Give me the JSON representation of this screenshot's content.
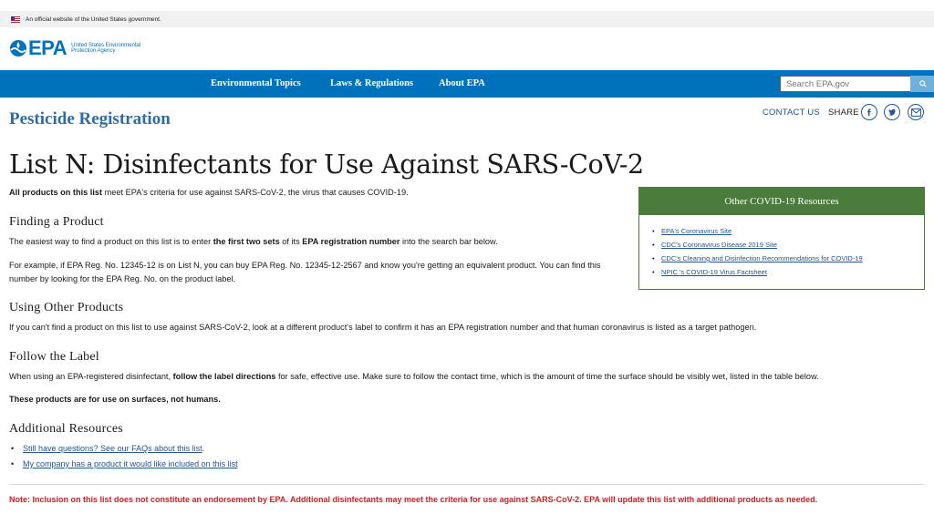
{
  "gov_banner": {
    "text": "An official website of the United States government."
  },
  "header": {
    "logo_text": "EPA",
    "logo_sub": "United States Environmental Protection Agency"
  },
  "nav": {
    "items": [
      "Environmental Topics",
      "Laws & Regulations",
      "About EPA"
    ],
    "search_placeholder": "Search EPA.gov"
  },
  "title_row": {
    "site_title": "Pesticide Registration",
    "contact": "CONTACT US",
    "share": "SHARE",
    "social_icons": [
      "facebook-icon",
      "twitter-icon",
      "email-icon"
    ]
  },
  "main": {
    "h1": "List N: Disinfectants for Use Against SARS-CoV-2",
    "intro_bold": "All products on this list",
    "intro_rest": " meet EPA's criteria for use against SARS-CoV-2, the virus that causes COVID-19.",
    "finding": {
      "heading": "Finding a Product",
      "p1_a": "The easiest way to find a product on this list is to enter ",
      "p1_b": "the first two sets",
      "p1_c": " of its ",
      "p1_d": "EPA registration number",
      "p1_e": " into the search bar below.",
      "p2_line1": "For example, if EPA Reg. No. 12345-12 is on List N, you can buy EPA Reg. No. 12345-12-2567 and know you're getting an equivalent product. You can find this",
      "p2_line2": "number by looking for the EPA Reg. No. on the product label."
    },
    "other": {
      "heading": "Using Other Products",
      "p": "If you can't find a product on this list to use against SARS-CoV-2, look at a different product's label to confirm it has an EPA registration number and that human coronavirus is listed as a target pathogen."
    },
    "label": {
      "heading": "Follow the Label",
      "p_a": "When using an EPA-registered disinfectant, ",
      "p_b": "follow the label directions",
      "p_c": " for safe, effective use. Make sure to follow the contact time, which is the amount of time the surface should be visibly wet, listed in the table below.",
      "p2": "These products are for use on surfaces, not humans."
    },
    "resources": {
      "heading": "Additional Resources",
      "links": [
        "Still have questions? See our FAQs about this list",
        "My company has a product it would like included on this list"
      ]
    },
    "note": "Note: Inclusion on this list does not constitute an endorsement by EPA. Additional disinfectants may meet the criteria for use against SARS-CoV-2. EPA will update this list with additional products as needed."
  },
  "sidebox": {
    "heading": "Other COVID-19 Resources",
    "links": [
      "EPA's Coronavirus Site",
      "CDC's Coronavirus Disease 2019 Site",
      "CDC's Cleaning and Disinfection Recommendations for COVID-19",
      "NPIC 's COVID-19 Virus Factsheet"
    ]
  },
  "colors": {
    "nav_blue": "#0071bc",
    "title_blue": "#2e6da4",
    "link_blue": "#205493",
    "box_green": "#4b7c3b",
    "note_red": "#cd2026"
  }
}
